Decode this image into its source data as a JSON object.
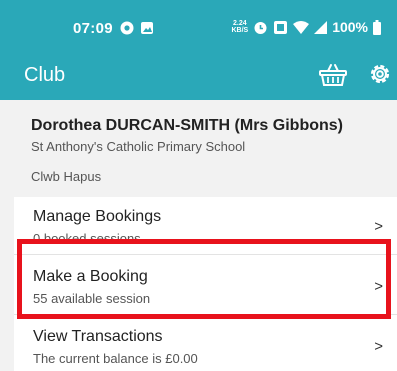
{
  "status_bar": {
    "time": "07:09",
    "data_rate_top": "2.24",
    "data_rate_bottom": "KB/S",
    "battery": "100%"
  },
  "app_bar": {
    "title": "Club",
    "basket_icon": "basket-icon",
    "settings_icon": "gear-icon"
  },
  "profile": {
    "name": "Dorothea DURCAN-SMITH (Mrs Gibbons)",
    "school": "St Anthony's Catholic Primary School",
    "club": "Clwb Hapus"
  },
  "menu": {
    "items": [
      {
        "label": "Manage Bookings",
        "sub": "0 booked sessions",
        "chevron": ">"
      },
      {
        "label": "Make a Booking",
        "sub": "55 available session",
        "chevron": ">"
      },
      {
        "label": "View Transactions",
        "sub": "The current balance is £0.00",
        "chevron": ">"
      }
    ]
  },
  "colors": {
    "primary": "#2aa8b8",
    "highlight": "#e8121c"
  }
}
